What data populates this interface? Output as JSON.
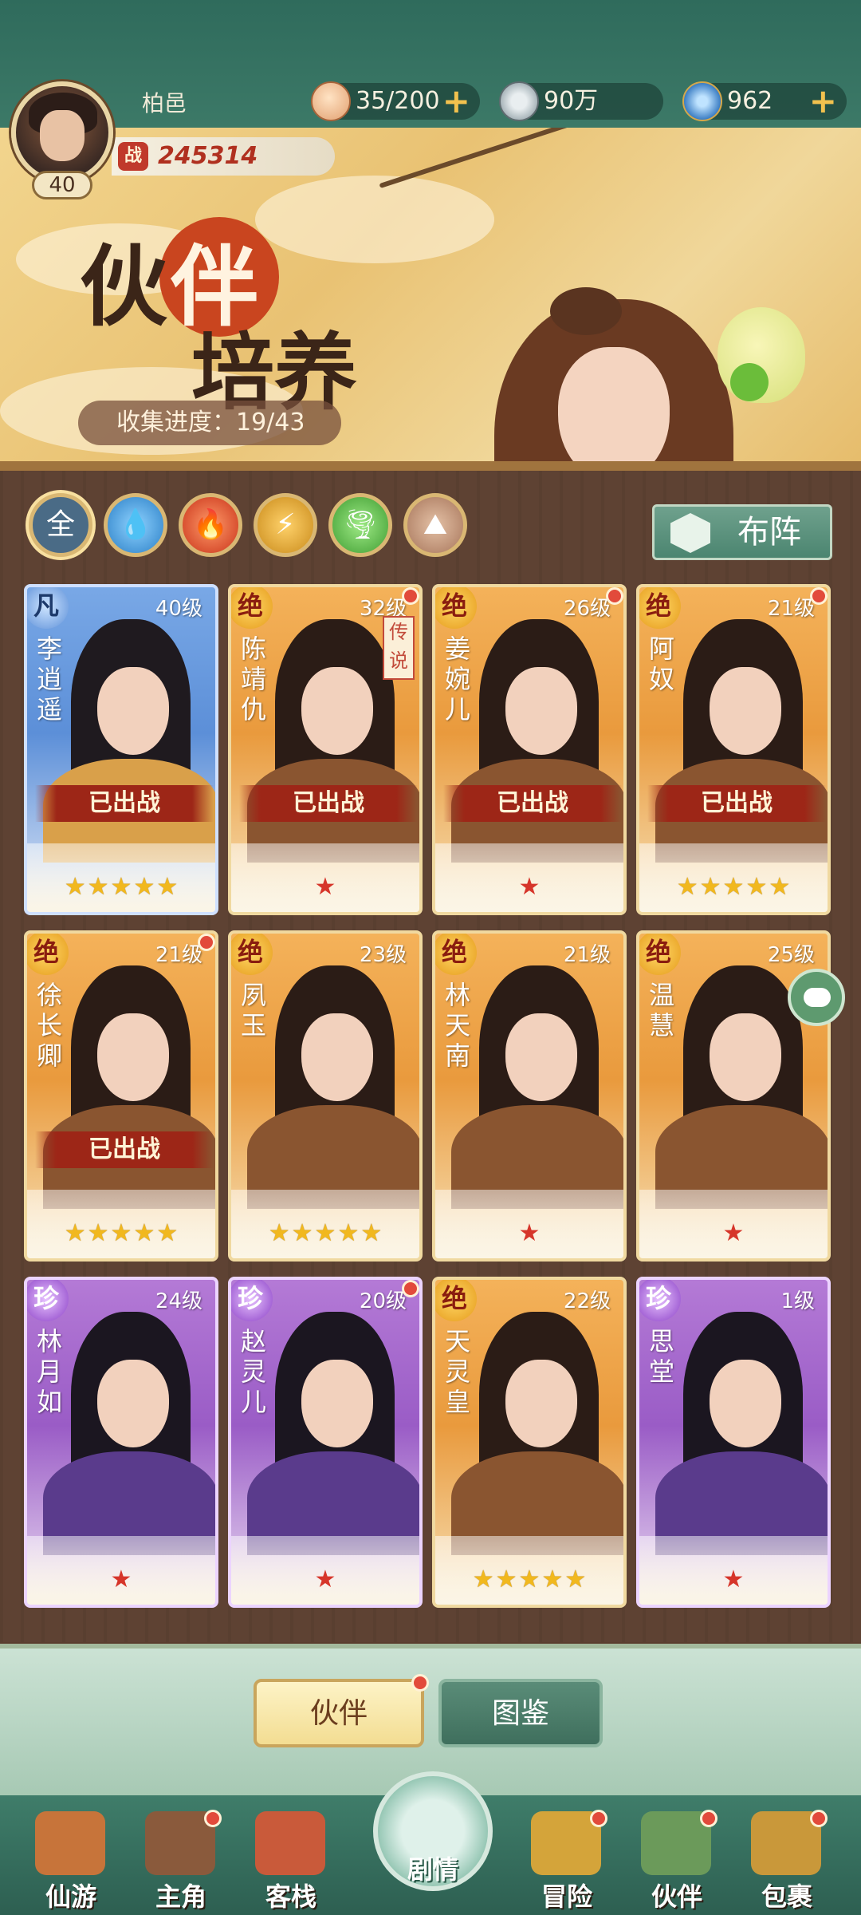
{
  "player": {
    "name": "柏邑",
    "level": "40",
    "power_label": "战",
    "power": "245314"
  },
  "resources": [
    {
      "icon": "bun-icon",
      "value": "35/200",
      "plus": "+"
    },
    {
      "icon": "coin-icon",
      "value": "90万"
    },
    {
      "icon": "jade-icon",
      "value": "962",
      "plus": "+"
    }
  ],
  "banner": {
    "title_1": "伙",
    "title_2": "伴",
    "title_3": "培养",
    "collect_label": "收集进度：19/43"
  },
  "filters": [
    {
      "name": "all",
      "label": "全"
    },
    {
      "name": "water",
      "label": ""
    },
    {
      "name": "fire",
      "label": ""
    },
    {
      "name": "thunder",
      "label": ""
    },
    {
      "name": "wind",
      "label": ""
    },
    {
      "name": "earth",
      "label": ""
    }
  ],
  "formation_button": "布阵",
  "deployed_label": "已出战",
  "legend_tag": "传说",
  "partners": [
    {
      "name": "李逍遥",
      "rarity": "凡",
      "level": "40级",
      "deployed": true,
      "stars": 5,
      "color": "blue",
      "reddot": false
    },
    {
      "name": "陈靖仇",
      "rarity": "绝",
      "level": "32级",
      "deployed": true,
      "stars": 1,
      "color": "gold",
      "reddot": true,
      "legend": true
    },
    {
      "name": "姜婉儿",
      "rarity": "绝",
      "level": "26级",
      "deployed": true,
      "stars": 1,
      "color": "gold",
      "reddot": true
    },
    {
      "name": "阿奴",
      "rarity": "绝",
      "level": "21级",
      "deployed": true,
      "stars": 5,
      "color": "gold",
      "reddot": true
    },
    {
      "name": "徐长卿",
      "rarity": "绝",
      "level": "21级",
      "deployed": true,
      "stars": 5,
      "color": "gold",
      "reddot": true
    },
    {
      "name": "夙玉",
      "rarity": "绝",
      "level": "23级",
      "deployed": false,
      "stars": 5,
      "color": "gold",
      "reddot": false
    },
    {
      "name": "林天南",
      "rarity": "绝",
      "level": "21级",
      "deployed": false,
      "stars": 1,
      "color": "gold",
      "reddot": false
    },
    {
      "name": "温慧",
      "rarity": "绝",
      "level": "25级",
      "deployed": false,
      "stars": 1,
      "color": "gold",
      "reddot": false
    },
    {
      "name": "林月如",
      "rarity": "珍",
      "level": "24级",
      "deployed": false,
      "stars": 1,
      "color": "purple",
      "reddot": false
    },
    {
      "name": "赵灵儿",
      "rarity": "珍",
      "level": "20级",
      "deployed": false,
      "stars": 1,
      "color": "purple",
      "reddot": true
    },
    {
      "name": "天灵皇",
      "rarity": "绝",
      "level": "22级",
      "deployed": false,
      "stars": 5,
      "color": "gold",
      "reddot": false
    },
    {
      "name": "思堂",
      "rarity": "珍",
      "level": "1级",
      "deployed": false,
      "stars": 1,
      "color": "purple",
      "reddot": false
    }
  ],
  "tabs": {
    "partner": "伙伴",
    "atlas": "图鉴"
  },
  "nav": [
    {
      "name": "xianyou",
      "label": "仙游",
      "reddot": false
    },
    {
      "name": "zhujiao",
      "label": "主角",
      "reddot": true
    },
    {
      "name": "kezhan",
      "label": "客栈",
      "reddot": false
    },
    {
      "name": "juqing",
      "label": "剧情",
      "reddot": false
    },
    {
      "name": "maoxian",
      "label": "冒险",
      "reddot": true
    },
    {
      "name": "huoban",
      "label": "伙伴",
      "reddot": true
    },
    {
      "name": "baoguo",
      "label": "包裹",
      "reddot": true
    }
  ]
}
